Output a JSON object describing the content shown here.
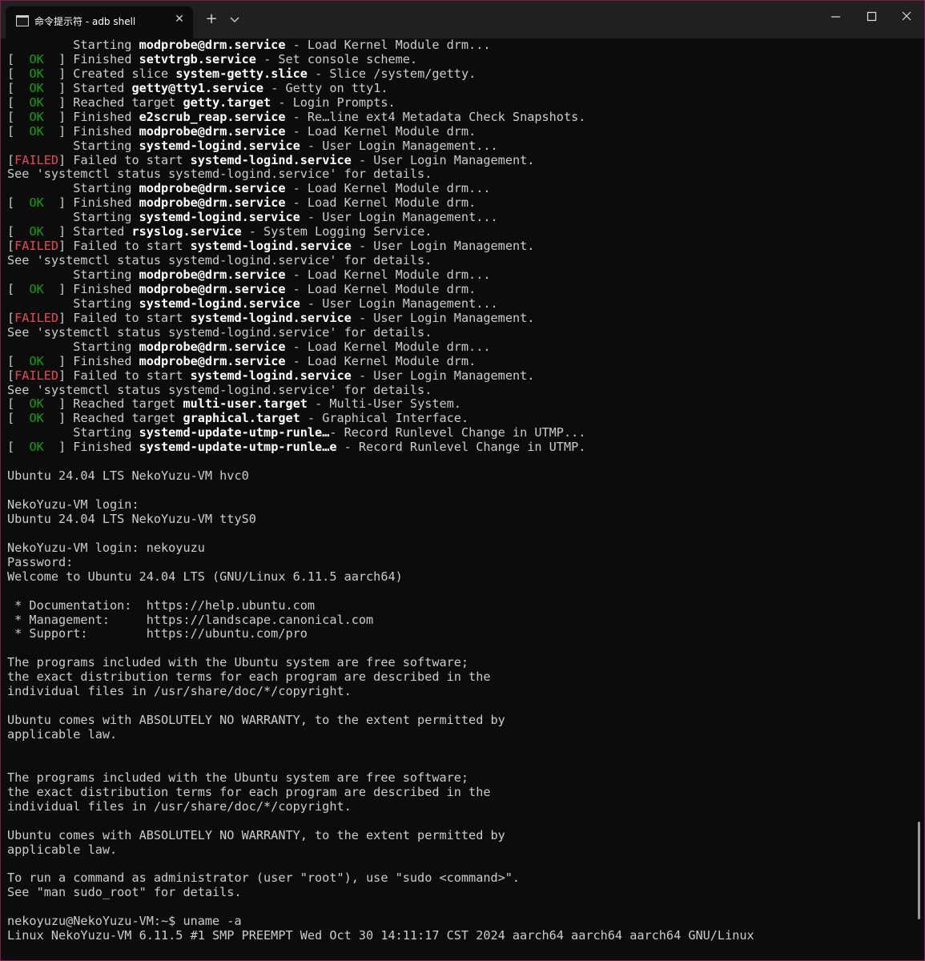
{
  "window": {
    "tab_title": "命令提示符 - adb  shell",
    "tab_close": "✕",
    "new_tab": "+",
    "accent_border": "#7a1f4a"
  },
  "colors": {
    "background": "#0c0c0c",
    "text": "#cccccc",
    "ok": "#13a10e",
    "failed": "#e74856",
    "bold": "#ffffff"
  },
  "terminal_lines": [
    [
      {
        "t": "         Starting "
      },
      {
        "t": "modprobe@drm.service",
        "c": "b"
      },
      {
        "t": " - Load Kernel Module drm..."
      }
    ],
    [
      {
        "t": "[  "
      },
      {
        "t": "OK",
        "c": "ok"
      },
      {
        "t": "  ] Finished "
      },
      {
        "t": "setvtrgb.service",
        "c": "b"
      },
      {
        "t": " - Set console scheme."
      }
    ],
    [
      {
        "t": "[  "
      },
      {
        "t": "OK",
        "c": "ok"
      },
      {
        "t": "  ] Created slice "
      },
      {
        "t": "system-getty.slice",
        "c": "b"
      },
      {
        "t": " - Slice /system/getty."
      }
    ],
    [
      {
        "t": "[  "
      },
      {
        "t": "OK",
        "c": "ok"
      },
      {
        "t": "  ] Started "
      },
      {
        "t": "getty@tty1.service",
        "c": "b"
      },
      {
        "t": " - Getty on tty1."
      }
    ],
    [
      {
        "t": "[  "
      },
      {
        "t": "OK",
        "c": "ok"
      },
      {
        "t": "  ] Reached target "
      },
      {
        "t": "getty.target",
        "c": "b"
      },
      {
        "t": " - Login Prompts."
      }
    ],
    [
      {
        "t": "[  "
      },
      {
        "t": "OK",
        "c": "ok"
      },
      {
        "t": "  ] Finished "
      },
      {
        "t": "e2scrub_reap.service",
        "c": "b"
      },
      {
        "t": " - Re…line ext4 Metadata Check Snapshots."
      }
    ],
    [
      {
        "t": "[  "
      },
      {
        "t": "OK",
        "c": "ok"
      },
      {
        "t": "  ] Finished "
      },
      {
        "t": "modprobe@drm.service",
        "c": "b"
      },
      {
        "t": " - Load Kernel Module drm."
      }
    ],
    [
      {
        "t": "         Starting "
      },
      {
        "t": "systemd-logind.service",
        "c": "b"
      },
      {
        "t": " - User Login Management..."
      }
    ],
    [
      {
        "t": "["
      },
      {
        "t": "FAILED",
        "c": "failed"
      },
      {
        "t": "] Failed to start "
      },
      {
        "t": "systemd-logind.service",
        "c": "b"
      },
      {
        "t": " - User Login Management."
      }
    ],
    [
      {
        "t": "See 'systemctl status systemd-logind.service' for details."
      }
    ],
    [
      {
        "t": "         Starting "
      },
      {
        "t": "modprobe@drm.service",
        "c": "b"
      },
      {
        "t": " - Load Kernel Module drm..."
      }
    ],
    [
      {
        "t": "[  "
      },
      {
        "t": "OK",
        "c": "ok"
      },
      {
        "t": "  ] Finished "
      },
      {
        "t": "modprobe@drm.service",
        "c": "b"
      },
      {
        "t": " - Load Kernel Module drm."
      }
    ],
    [
      {
        "t": "         Starting "
      },
      {
        "t": "systemd-logind.service",
        "c": "b"
      },
      {
        "t": " - User Login Management..."
      }
    ],
    [
      {
        "t": "[  "
      },
      {
        "t": "OK",
        "c": "ok"
      },
      {
        "t": "  ] Started "
      },
      {
        "t": "rsyslog.service",
        "c": "b"
      },
      {
        "t": " - System Logging Service."
      }
    ],
    [
      {
        "t": "["
      },
      {
        "t": "FAILED",
        "c": "failed"
      },
      {
        "t": "] Failed to start "
      },
      {
        "t": "systemd-logind.service",
        "c": "b"
      },
      {
        "t": " - User Login Management."
      }
    ],
    [
      {
        "t": "See 'systemctl status systemd-logind.service' for details."
      }
    ],
    [
      {
        "t": "         Starting "
      },
      {
        "t": "modprobe@drm.service",
        "c": "b"
      },
      {
        "t": " - Load Kernel Module drm..."
      }
    ],
    [
      {
        "t": "[  "
      },
      {
        "t": "OK",
        "c": "ok"
      },
      {
        "t": "  ] Finished "
      },
      {
        "t": "modprobe@drm.service",
        "c": "b"
      },
      {
        "t": " - Load Kernel Module drm."
      }
    ],
    [
      {
        "t": "         Starting "
      },
      {
        "t": "systemd-logind.service",
        "c": "b"
      },
      {
        "t": " - User Login Management..."
      }
    ],
    [
      {
        "t": "["
      },
      {
        "t": "FAILED",
        "c": "failed"
      },
      {
        "t": "] Failed to start "
      },
      {
        "t": "systemd-logind.service",
        "c": "b"
      },
      {
        "t": " - User Login Management."
      }
    ],
    [
      {
        "t": "See 'systemctl status systemd-logind.service' for details."
      }
    ],
    [
      {
        "t": "         Starting "
      },
      {
        "t": "modprobe@drm.service",
        "c": "b"
      },
      {
        "t": " - Load Kernel Module drm..."
      }
    ],
    [
      {
        "t": "[  "
      },
      {
        "t": "OK",
        "c": "ok"
      },
      {
        "t": "  ] Finished "
      },
      {
        "t": "modprobe@drm.service",
        "c": "b"
      },
      {
        "t": " - Load Kernel Module drm."
      }
    ],
    [
      {
        "t": "["
      },
      {
        "t": "FAILED",
        "c": "failed"
      },
      {
        "t": "] Failed to start "
      },
      {
        "t": "systemd-logind.service",
        "c": "b"
      },
      {
        "t": " - User Login Management."
      }
    ],
    [
      {
        "t": "See 'systemctl status systemd-logind.service' for details."
      }
    ],
    [
      {
        "t": "[  "
      },
      {
        "t": "OK",
        "c": "ok"
      },
      {
        "t": "  ] Reached target "
      },
      {
        "t": "multi-user.target",
        "c": "b"
      },
      {
        "t": " - Multi-User System."
      }
    ],
    [
      {
        "t": "[  "
      },
      {
        "t": "OK",
        "c": "ok"
      },
      {
        "t": "  ] Reached target "
      },
      {
        "t": "graphical.target",
        "c": "b"
      },
      {
        "t": " - Graphical Interface."
      }
    ],
    [
      {
        "t": "         Starting "
      },
      {
        "t": "systemd-update-utmp-runle…",
        "c": "b"
      },
      {
        "t": "- Record Runlevel Change in UTMP..."
      }
    ],
    [
      {
        "t": "[  "
      },
      {
        "t": "OK",
        "c": "ok"
      },
      {
        "t": "  ] Finished "
      },
      {
        "t": "systemd-update-utmp-runle…e",
        "c": "b"
      },
      {
        "t": " - Record Runlevel Change in UTMP."
      }
    ],
    [
      {
        "t": ""
      }
    ],
    [
      {
        "t": "Ubuntu 24.04 LTS NekoYuzu-VM hvc0"
      }
    ],
    [
      {
        "t": ""
      }
    ],
    [
      {
        "t": "NekoYuzu-VM login:"
      }
    ],
    [
      {
        "t": "Ubuntu 24.04 LTS NekoYuzu-VM ttyS0"
      }
    ],
    [
      {
        "t": ""
      }
    ],
    [
      {
        "t": "NekoYuzu-VM login: nekoyuzu"
      }
    ],
    [
      {
        "t": "Password:"
      }
    ],
    [
      {
        "t": "Welcome to Ubuntu 24.04 LTS (GNU/Linux 6.11.5 aarch64)"
      }
    ],
    [
      {
        "t": ""
      }
    ],
    [
      {
        "t": " * Documentation:  https://help.ubuntu.com"
      }
    ],
    [
      {
        "t": " * Management:     https://landscape.canonical.com"
      }
    ],
    [
      {
        "t": " * Support:        https://ubuntu.com/pro"
      }
    ],
    [
      {
        "t": ""
      }
    ],
    [
      {
        "t": "The programs included with the Ubuntu system are free software;"
      }
    ],
    [
      {
        "t": "the exact distribution terms for each program are described in the"
      }
    ],
    [
      {
        "t": "individual files in /usr/share/doc/*/copyright."
      }
    ],
    [
      {
        "t": ""
      }
    ],
    [
      {
        "t": "Ubuntu comes with ABSOLUTELY NO WARRANTY, to the extent permitted by"
      }
    ],
    [
      {
        "t": "applicable law."
      }
    ],
    [
      {
        "t": ""
      }
    ],
    [
      {
        "t": ""
      }
    ],
    [
      {
        "t": "The programs included with the Ubuntu system are free software;"
      }
    ],
    [
      {
        "t": "the exact distribution terms for each program are described in the"
      }
    ],
    [
      {
        "t": "individual files in /usr/share/doc/*/copyright."
      }
    ],
    [
      {
        "t": ""
      }
    ],
    [
      {
        "t": "Ubuntu comes with ABSOLUTELY NO WARRANTY, to the extent permitted by"
      }
    ],
    [
      {
        "t": "applicable law."
      }
    ],
    [
      {
        "t": ""
      }
    ],
    [
      {
        "t": "To run a command as administrator (user \"root\"), use \"sudo <command>\"."
      }
    ],
    [
      {
        "t": "See \"man sudo_root\" for details."
      }
    ],
    [
      {
        "t": ""
      }
    ],
    [
      {
        "t": "nekoyuzu@NekoYuzu-VM:~$ uname -a"
      }
    ],
    [
      {
        "t": "Linux NekoYuzu-VM 6.11.5 #1 SMP PREEMPT Wed Oct 30 14:11:17 CST 2024 aarch64 aarch64 aarch64 GNU/Linux"
      }
    ]
  ],
  "icons": {
    "tab_icon": "terminal-icon",
    "minimize": "minimize-icon",
    "maximize": "maximize-icon",
    "close": "close-icon",
    "dropdown": "chevron-down-icon"
  }
}
